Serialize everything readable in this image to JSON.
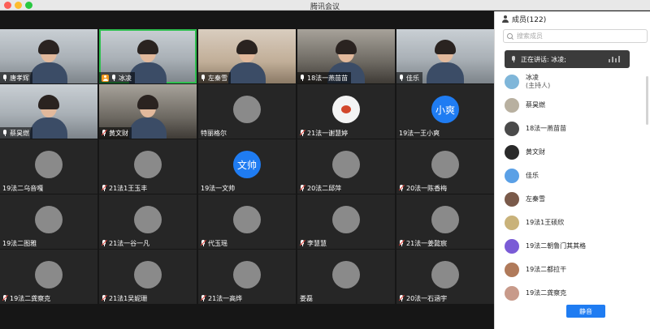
{
  "window": {
    "title": "腾讯会议"
  },
  "tiles": [
    {
      "name": "唐孝辉",
      "kind": "cam",
      "tone": "light",
      "mic": "on"
    },
    {
      "name": "冰凌",
      "kind": "cam",
      "tone": "light",
      "mic": "host",
      "active": true
    },
    {
      "name": "左秦雪",
      "kind": "cam",
      "tone": "warm",
      "mic": "on"
    },
    {
      "name": "18法一燕苗苗",
      "kind": "cam",
      "tone": "dark",
      "mic": "on"
    },
    {
      "name": "佳乐",
      "kind": "cam",
      "tone": "light",
      "mic": "on"
    },
    {
      "name": "蔡昊燃",
      "kind": "cam",
      "tone": "light",
      "mic": "on"
    },
    {
      "name": "黄文财",
      "kind": "cam",
      "tone": "dark",
      "mic": "muted"
    },
    {
      "name": "特丽格尔",
      "kind": "avatar",
      "mic": "none"
    },
    {
      "name": "21法一谢慧婷",
      "kind": "avatar",
      "avatarStyle": "white",
      "mic": "muted"
    },
    {
      "name": "19法一王小爽",
      "kind": "text",
      "avatarText": "小爽",
      "mic": "none"
    },
    {
      "name": "19法二乌音嘎",
      "kind": "avatar",
      "mic": "none"
    },
    {
      "name": "21法1王玉丰",
      "kind": "avatar",
      "mic": "muted"
    },
    {
      "name": "19法一文帅",
      "kind": "text",
      "avatarText": "文帅",
      "mic": "none"
    },
    {
      "name": "20法二邱萍",
      "kind": "avatar",
      "mic": "muted"
    },
    {
      "name": "20法一陈香梅",
      "kind": "avatar",
      "mic": "muted"
    },
    {
      "name": "19法二图雅",
      "kind": "avatar",
      "mic": "none"
    },
    {
      "name": "21法一谷一凡",
      "kind": "avatar",
      "mic": "muted"
    },
    {
      "name": "代玉瑶",
      "kind": "avatar",
      "mic": "muted"
    },
    {
      "name": "李慧慧",
      "kind": "avatar",
      "mic": "muted"
    },
    {
      "name": "21法一姜懿宸",
      "kind": "avatar",
      "mic": "muted"
    },
    {
      "name": "19法二龚察克",
      "kind": "avatar",
      "mic": "muted"
    },
    {
      "name": "21法1吴妮珊",
      "kind": "avatar",
      "mic": "muted"
    },
    {
      "name": "21法一高烨",
      "kind": "avatar",
      "mic": "muted"
    },
    {
      "name": "娄磊",
      "kind": "avatar",
      "mic": "none"
    },
    {
      "name": "20法一石涵宇",
      "kind": "avatar",
      "mic": "muted"
    }
  ],
  "panel": {
    "header": "成员(122)",
    "search_placeholder": "搜索成员",
    "speaking": "正在讲话: 冰凌;",
    "members": [
      {
        "name": "冰凌",
        "sub": "(主持人)",
        "color": "#7fb6d9"
      },
      {
        "name": "蔡昊燃",
        "color": "#b8b0a0"
      },
      {
        "name": "18法一燕苗苗",
        "color": "#4a4a4a"
      },
      {
        "name": "黄文财",
        "color": "#2a2a2a"
      },
      {
        "name": "佳乐",
        "color": "#5aa0e6"
      },
      {
        "name": "左秦雪",
        "color": "#7a5a4a"
      },
      {
        "name": "19法1王硕欣",
        "color": "#c9b27a"
      },
      {
        "name": "19法二朝鲁门其其格",
        "color": "#7a5bd6"
      },
      {
        "name": "19法二都拉干",
        "color": "#b07a5a"
      },
      {
        "name": "19法二龚察克",
        "color": "#c89a8a"
      }
    ],
    "mute_label": "静音"
  }
}
